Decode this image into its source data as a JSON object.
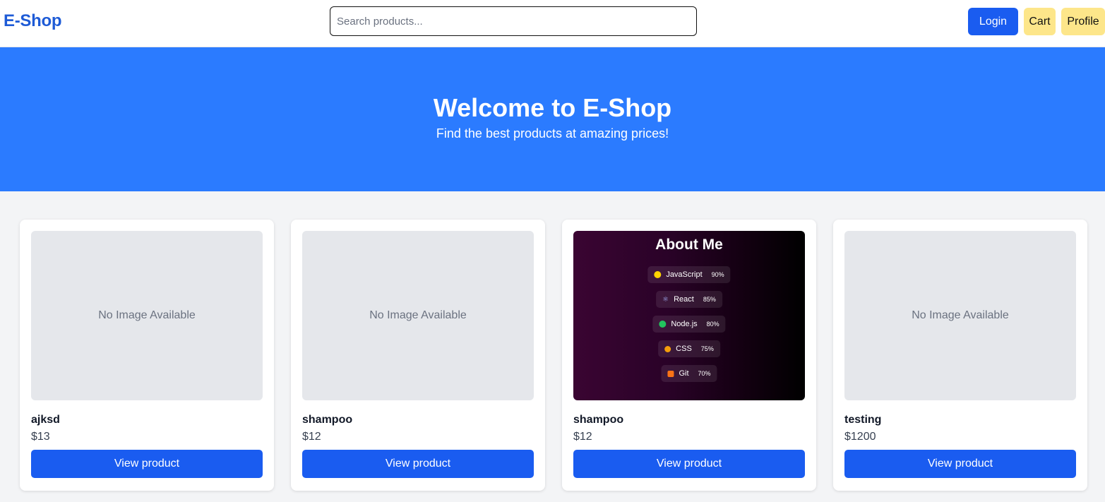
{
  "nav": {
    "logo": "E-Shop",
    "search_placeholder": "Search products...",
    "login": "Login",
    "cart": "Cart",
    "profile": "Profile"
  },
  "hero": {
    "title": "Welcome to E-Shop",
    "subtitle": "Find the best products at amazing prices!"
  },
  "products": [
    {
      "name": "ajksd",
      "price": "$13",
      "image_placeholder": "No Image Available",
      "button": "View product"
    },
    {
      "name": "shampoo",
      "price": "$12",
      "image_placeholder": "No Image Available",
      "button": "View product"
    },
    {
      "name": "shampoo",
      "price": "$12",
      "button": "View product",
      "image": {
        "title": "About Me",
        "skills": [
          {
            "name": "JavaScript",
            "percent": "90%",
            "icon": "yellow-dot"
          },
          {
            "name": "React",
            "percent": "85%",
            "icon": "react-icon"
          },
          {
            "name": "Node.js",
            "percent": "80%",
            "icon": "green-dot"
          },
          {
            "name": "CSS",
            "percent": "75%",
            "icon": "palette-icon"
          },
          {
            "name": "Git",
            "percent": "70%",
            "icon": "fox-icon"
          }
        ]
      }
    },
    {
      "name": "testing",
      "price": "$1200",
      "image_placeholder": "No Image Available",
      "button": "View product"
    }
  ],
  "colors": {
    "brand": "#1e5bd6",
    "hero_bg": "#2b7bff",
    "primary_button": "#1a5cf0",
    "secondary_button": "#fde68a",
    "page_bg": "#f3f4f6"
  }
}
